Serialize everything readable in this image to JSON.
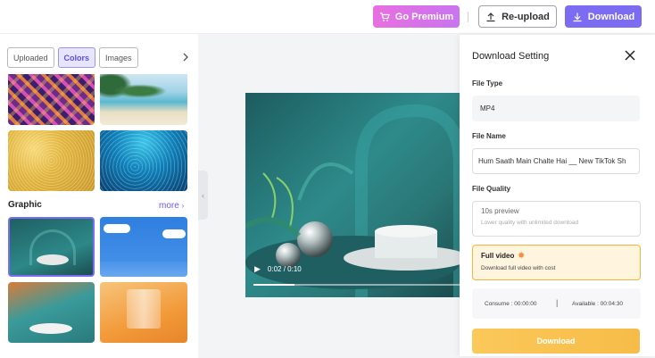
{
  "topbar": {
    "premium_label": "Go Premium",
    "reupload_label": "Re-upload",
    "download_label": "Download"
  },
  "left": {
    "tabs": [
      {
        "label": "Uploaded",
        "active": false
      },
      {
        "label": "Colors",
        "active": true
      },
      {
        "label": "Images",
        "active": false
      }
    ],
    "section_label": "Graphic",
    "more_label": "more"
  },
  "video": {
    "time": "0:02 / 0:10",
    "progress": 0.2
  },
  "dialog": {
    "title": "Download Setting",
    "file_type_label": "File Type",
    "file_type_value": "MP4",
    "file_name_label": "File Name",
    "file_name_value": "Hum Saath Main Chalte Hai __ New TikTok Sh",
    "file_quality_label": "File Quality",
    "preview_title": "10s preview",
    "preview_desc": "Lower quality with unlimited download",
    "full_title": "Full video",
    "full_desc": "Download full video with cost",
    "consume": "Consume : 00:00:00",
    "separator": "|",
    "available": "Available : 00:04:30",
    "download_label": "Download"
  },
  "colors": {
    "accent": "#7b6cf2",
    "premium": "#e86fe0",
    "highlight": "#f4b73b"
  }
}
